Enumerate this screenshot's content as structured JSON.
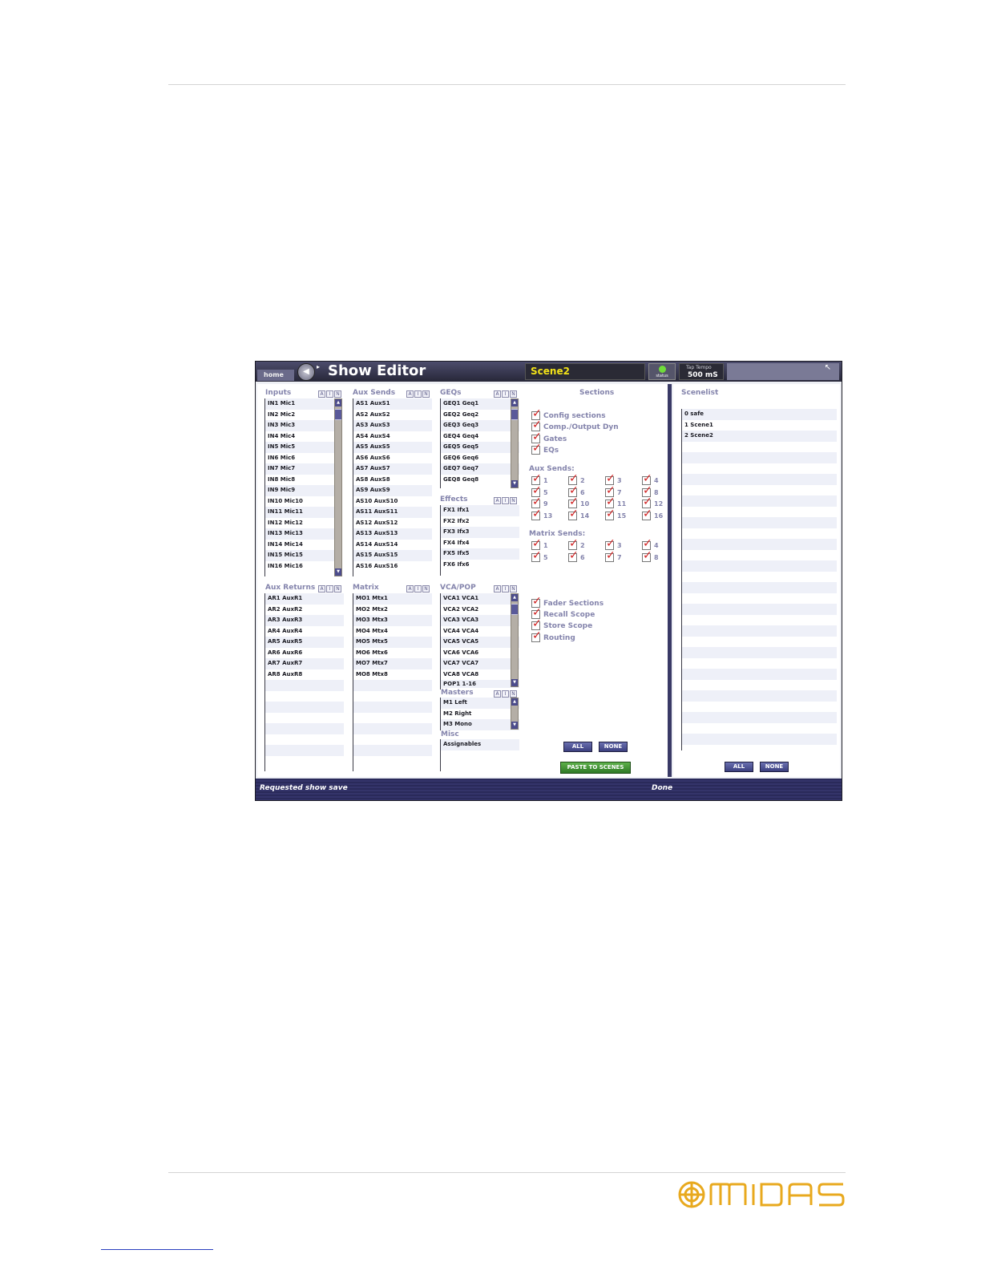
{
  "window": {
    "home_tab": "home",
    "title": "Show Editor",
    "scene": "Scene2",
    "status_label": "status",
    "tempo_label": "Tap Tempo",
    "tempo_value": "500 mS"
  },
  "panels": {
    "inputs": {
      "title": "Inputs",
      "items": [
        "IN1 Mic1",
        "IN2 Mic2",
        "IN3 Mic3",
        "IN4 Mic4",
        "IN5 Mic5",
        "IN6 Mic6",
        "IN7 Mic7",
        "IN8 Mic8",
        "IN9 Mic9",
        "IN10 Mic10",
        "IN11 Mic11",
        "IN12 Mic12",
        "IN13 Mic13",
        "IN14 Mic14",
        "IN15 Mic15",
        "IN16 Mic16"
      ]
    },
    "aux_sends": {
      "title": "Aux Sends",
      "items": [
        "AS1 AuxS1",
        "AS2 AuxS2",
        "AS3 AuxS3",
        "AS4 AuxS4",
        "AS5 AuxS5",
        "AS6 AuxS6",
        "AS7 AuxS7",
        "AS8 AuxS8",
        "AS9 AuxS9",
        "AS10 AuxS10",
        "AS11 AuxS11",
        "AS12 AuxS12",
        "AS13 AuxS13",
        "AS14 AuxS14",
        "AS15 AuxS15",
        "AS16 AuxS16"
      ]
    },
    "geqs": {
      "title": "GEQs",
      "items": [
        "GEQ1 Geq1",
        "GEQ2 Geq2",
        "GEQ3 Geq3",
        "GEQ4 Geq4",
        "GEQ5 Geq5",
        "GEQ6 Geq6",
        "GEQ7 Geq7",
        "GEQ8 Geq8"
      ]
    },
    "effects": {
      "title": "Effects",
      "items": [
        "FX1 Ifx1",
        "FX2 Ifx2",
        "FX3 Ifx3",
        "FX4 Ifx4",
        "FX5 Ifx5",
        "FX6 Ifx6"
      ]
    },
    "aux_returns": {
      "title": "Aux Returns",
      "items": [
        "AR1 AuxR1",
        "AR2 AuxR2",
        "AR3 AuxR3",
        "AR4 AuxR4",
        "AR5 AuxR5",
        "AR6 AuxR6",
        "AR7 AuxR7",
        "AR8 AuxR8"
      ]
    },
    "matrix": {
      "title": "Matrix",
      "items": [
        "MO1 Mtx1",
        "MO2 Mtx2",
        "MO3 Mtx3",
        "MO4 Mtx4",
        "MO5 Mtx5",
        "MO6 Mtx6",
        "MO7 Mtx7",
        "MO8 Mtx8"
      ]
    },
    "vca_pop": {
      "title": "VCA/POP",
      "items": [
        "VCA1 VCA1",
        "VCA2 VCA2",
        "VCA3 VCA3",
        "VCA4 VCA4",
        "VCA5 VCA5",
        "VCA6 VCA6",
        "VCA7 VCA7",
        "VCA8 VCA8",
        "POP1 1-16"
      ]
    },
    "masters": {
      "title": "Masters",
      "items": [
        "M1 Left",
        "M2 Right",
        "M3 Mono"
      ]
    },
    "misc": {
      "title": "Misc",
      "items": [
        "Assignables"
      ]
    },
    "ain": [
      "A",
      "I",
      "N"
    ]
  },
  "sections": {
    "title": "Sections",
    "main": [
      "Config sections",
      "Comp./Output Dyn",
      "Gates",
      "EQs"
    ],
    "aux_sends_title": "Aux Sends:",
    "aux_sends": [
      "1",
      "2",
      "3",
      "4",
      "5",
      "6",
      "7",
      "8",
      "9",
      "10",
      "11",
      "12",
      "13",
      "14",
      "15",
      "16"
    ],
    "matrix_sends_title": "Matrix Sends:",
    "matrix_sends": [
      "1",
      "2",
      "3",
      "4",
      "5",
      "6",
      "7",
      "8"
    ],
    "lower": [
      "Fader Sections",
      "Recall Scope",
      "Store Scope",
      "Routing"
    ],
    "all_button": "ALL",
    "none_button": "NONE",
    "paste_button": "PASTE TO SCENES"
  },
  "scenelist": {
    "title": "Scenelist",
    "items": [
      "0 safe",
      "1 Scene1",
      "2 Scene2"
    ],
    "all_button": "ALL",
    "none_button": "NONE"
  },
  "statusbar": {
    "left": "Requested show save",
    "right": "Done"
  },
  "brand": {
    "logo_text": "MIDAS",
    "logo_color": "#e8a91e"
  }
}
